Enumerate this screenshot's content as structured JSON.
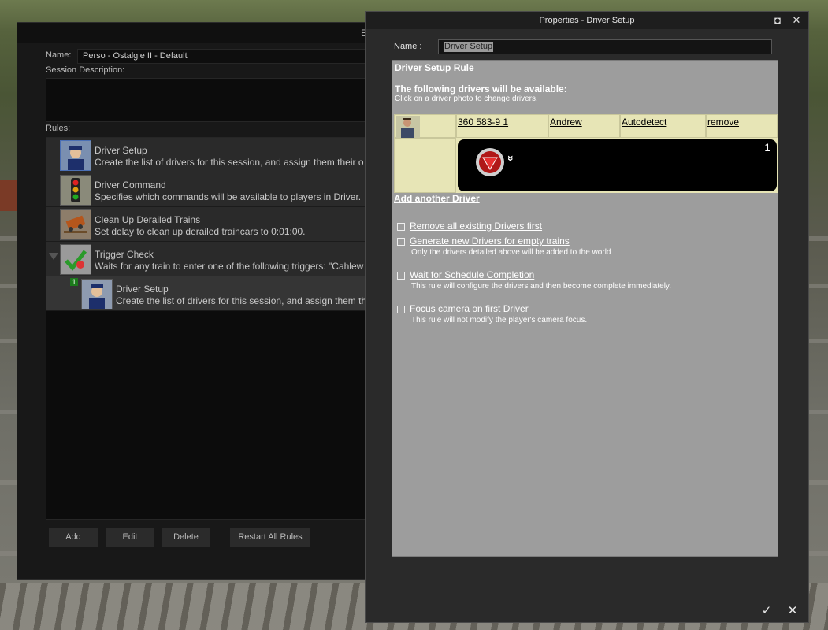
{
  "edit_window": {
    "title_fragment": "Ec",
    "name_label": "Name:",
    "name_value": "Perso - Ostalgie II - Default",
    "session_description_label": "Session Description:",
    "rules_label": "Rules:",
    "rules": [
      {
        "title": "Driver Setup",
        "description": "Create the list of drivers for this session, and assign them their o",
        "icon": "driver-icon"
      },
      {
        "title": "Driver Command",
        "description": "Specifies which commands will be available to players in Driver.",
        "icon": "traffic-light-icon"
      },
      {
        "title": "Clean Up Derailed Trains",
        "description": "Set delay to clean up derailed traincars to 0:01:00.",
        "icon": "derailed-train-icon"
      },
      {
        "title": "Trigger Check",
        "description": "Waits for any train to enter one of the following triggers: \"Cahlew",
        "icon": "trigger-check-icon"
      }
    ],
    "child_rule": {
      "badge": "1",
      "title": "Driver Setup",
      "description": "Create the list of drivers for this session, and assign them th",
      "icon": "driver-icon"
    },
    "buttons": {
      "add": "Add",
      "edit": "Edit",
      "delete": "Delete",
      "restart": "Restart All Rules"
    }
  },
  "properties_window": {
    "title": "Properties - Driver Setup",
    "name_label": "Name :",
    "name_value": "Driver Setup",
    "panel_title": "Driver Setup Rule",
    "heading": "The following drivers will be available:",
    "hint": "Click on a driver photo to change drivers.",
    "driver_row": {
      "train_id": "360 583-9 1",
      "driver_name": "Andrew",
      "mode": "Autodetect",
      "remove": "remove"
    },
    "driver_card": {
      "number": "1",
      "expand_symbol": "»"
    },
    "add_driver": "Add another Driver",
    "options": [
      {
        "label": "Remove all existing Drivers first",
        "hint": "",
        "checked": false
      },
      {
        "label": "Generate new Drivers for empty trains",
        "hint": "Only the drivers detailed above will be added to the world",
        "checked": false
      },
      {
        "label": "Wait for Schedule Completion",
        "hint": "This rule will configure the drivers and then become complete immediately.",
        "checked": false
      },
      {
        "label": "Focus camera on first Driver",
        "hint": "This rule will not modify the player's camera focus.",
        "checked": false
      }
    ],
    "ok_symbol": "✓",
    "cancel_symbol": "✕",
    "maximize_symbol": "◘",
    "close_symbol": "✕"
  }
}
